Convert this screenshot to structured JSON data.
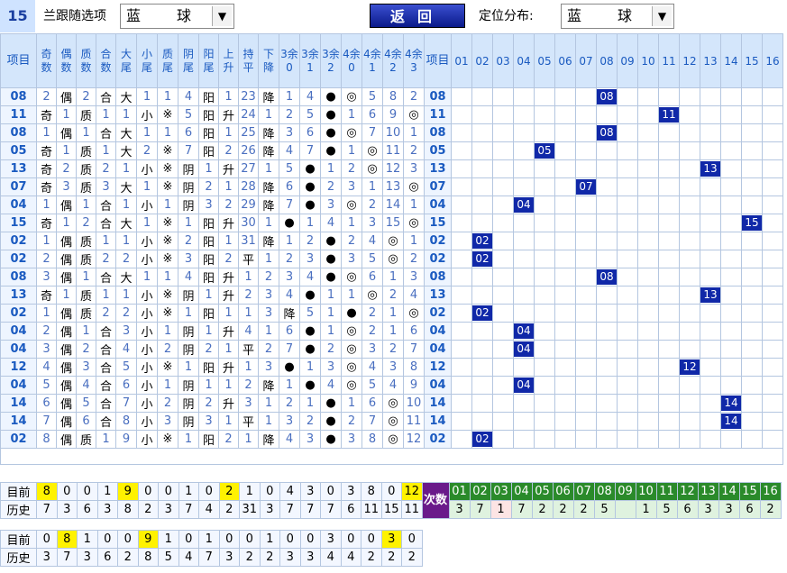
{
  "header": {
    "number": "15",
    "follow_label": "兰跟随选项",
    "follow_value": "蓝　球",
    "back_label": "返回",
    "pos_label": "定位分布:",
    "pos_value": "蓝　球"
  },
  "columns": [
    "奇数",
    "偶数",
    "质数",
    "合数",
    "大尾",
    "小尾",
    "质尾",
    "阴尾",
    "阳尾",
    "上升",
    "持平",
    "下降",
    "3余0",
    "3余1",
    "3余2",
    "4余0",
    "4余1",
    "4余2",
    "4余3"
  ],
  "item_label": "项目",
  "pos_numbers": [
    "01",
    "02",
    "03",
    "04",
    "05",
    "06",
    "07",
    "08",
    "09",
    "10",
    "11",
    "12",
    "13",
    "14",
    "15",
    "16"
  ],
  "rows": [
    {
      "item": "08",
      "cells": [
        "2",
        "偶",
        "2",
        "合",
        "大",
        "1",
        "1",
        "4",
        "阳",
        "1",
        "23",
        "降",
        "1",
        "4",
        "●",
        "◎",
        "5",
        "8",
        "2"
      ]
    },
    {
      "item": "11",
      "cells": [
        "奇",
        "1",
        "质",
        "1",
        "1",
        "小",
        "※",
        "5",
        "阳",
        "升",
        "24",
        "1",
        "2",
        "5",
        "●",
        "1",
        "6",
        "9",
        "◎"
      ]
    },
    {
      "item": "08",
      "cells": [
        "1",
        "偶",
        "1",
        "合",
        "大",
        "1",
        "1",
        "6",
        "阳",
        "1",
        "25",
        "降",
        "3",
        "6",
        "●",
        "◎",
        "7",
        "10",
        "1"
      ]
    },
    {
      "item": "05",
      "cells": [
        "奇",
        "1",
        "质",
        "1",
        "大",
        "2",
        "※",
        "7",
        "阳",
        "2",
        "26",
        "降",
        "4",
        "7",
        "●",
        "1",
        "◎",
        "11",
        "2"
      ]
    },
    {
      "item": "13",
      "cells": [
        "奇",
        "2",
        "质",
        "2",
        "1",
        "小",
        "※",
        "阴",
        "1",
        "升",
        "27",
        "1",
        "5",
        "●",
        "1",
        "2",
        "◎",
        "12",
        "3"
      ]
    },
    {
      "item": "07",
      "cells": [
        "奇",
        "3",
        "质",
        "3",
        "大",
        "1",
        "※",
        "阴",
        "2",
        "1",
        "28",
        "降",
        "6",
        "●",
        "2",
        "3",
        "1",
        "13",
        "◎"
      ]
    },
    {
      "item": "04",
      "cells": [
        "1",
        "偶",
        "1",
        "合",
        "1",
        "小",
        "1",
        "阴",
        "3",
        "2",
        "29",
        "降",
        "7",
        "●",
        "3",
        "◎",
        "2",
        "14",
        "1"
      ]
    },
    {
      "item": "15",
      "cells": [
        "奇",
        "1",
        "2",
        "合",
        "大",
        "1",
        "※",
        "1",
        "阳",
        "升",
        "30",
        "1",
        "●",
        "1",
        "4",
        "1",
        "3",
        "15",
        "◎"
      ]
    },
    {
      "item": "02",
      "cells": [
        "1",
        "偶",
        "质",
        "1",
        "1",
        "小",
        "※",
        "2",
        "阳",
        "1",
        "31",
        "降",
        "1",
        "2",
        "●",
        "2",
        "4",
        "◎",
        "1"
      ]
    },
    {
      "item": "02",
      "cells": [
        "2",
        "偶",
        "质",
        "2",
        "2",
        "小",
        "※",
        "3",
        "阳",
        "2",
        "平",
        "1",
        "2",
        "3",
        "●",
        "3",
        "5",
        "◎",
        "2"
      ]
    },
    {
      "item": "08",
      "cells": [
        "3",
        "偶",
        "1",
        "合",
        "大",
        "1",
        "1",
        "4",
        "阳",
        "升",
        "1",
        "2",
        "3",
        "4",
        "●",
        "◎",
        "6",
        "1",
        "3"
      ]
    },
    {
      "item": "13",
      "cells": [
        "奇",
        "1",
        "质",
        "1",
        "1",
        "小",
        "※",
        "阴",
        "1",
        "升",
        "2",
        "3",
        "4",
        "●",
        "1",
        "1",
        "◎",
        "2",
        "4"
      ]
    },
    {
      "item": "02",
      "cells": [
        "1",
        "偶",
        "质",
        "2",
        "2",
        "小",
        "※",
        "1",
        "阳",
        "1",
        "1",
        "3",
        "降",
        "5",
        "1",
        "●",
        "2",
        "1",
        "◎",
        "5"
      ]
    },
    {
      "item": "04",
      "cells": [
        "2",
        "偶",
        "1",
        "合",
        "3",
        "小",
        "1",
        "阴",
        "1",
        "升",
        "4",
        "1",
        "6",
        "●",
        "1",
        "◎",
        "2",
        "1",
        "6"
      ]
    },
    {
      "item": "04",
      "cells": [
        "3",
        "偶",
        "2",
        "合",
        "4",
        "小",
        "2",
        "阴",
        "2",
        "1",
        "平",
        "2",
        "7",
        "●",
        "2",
        "◎",
        "3",
        "2",
        "7"
      ]
    },
    {
      "item": "12",
      "cells": [
        "4",
        "偶",
        "3",
        "合",
        "5",
        "小",
        "※",
        "1",
        "阳",
        "升",
        "1",
        "3",
        "●",
        "1",
        "3",
        "◎",
        "4",
        "3",
        "8"
      ]
    },
    {
      "item": "04",
      "cells": [
        "5",
        "偶",
        "4",
        "合",
        "6",
        "小",
        "1",
        "阴",
        "1",
        "1",
        "2",
        "降",
        "1",
        "●",
        "4",
        "◎",
        "5",
        "4",
        "9"
      ]
    },
    {
      "item": "14",
      "cells": [
        "6",
        "偶",
        "5",
        "合",
        "7",
        "小",
        "2",
        "阴",
        "2",
        "升",
        "3",
        "1",
        "2",
        "1",
        "●",
        "1",
        "6",
        "◎",
        "10"
      ]
    },
    {
      "item": "14",
      "cells": [
        "7",
        "偶",
        "6",
        "合",
        "8",
        "小",
        "3",
        "阴",
        "3",
        "1",
        "平",
        "1",
        "3",
        "2",
        "●",
        "2",
        "7",
        "◎",
        "11"
      ]
    },
    {
      "item": "02",
      "cells": [
        "8",
        "偶",
        "质",
        "1",
        "9",
        "小",
        "※",
        "1",
        "阳",
        "2",
        "1",
        "降",
        "4",
        "3",
        "●",
        "3",
        "8",
        "◎",
        "12"
      ]
    }
  ],
  "bottom": {
    "current_label": "目前",
    "history_label": "历史",
    "cishu_label": "次数",
    "current": [
      "8",
      "0",
      "0",
      "1",
      "9",
      "0",
      "0",
      "1",
      "0",
      "2",
      "1",
      "0",
      "4",
      "3",
      "0",
      "3",
      "8",
      "0",
      "12"
    ],
    "history": [
      "7",
      "3",
      "6",
      "3",
      "8",
      "2",
      "3",
      "7",
      "4",
      "2",
      "31",
      "3",
      "7",
      "7",
      "7",
      "6",
      "11",
      "15",
      "11"
    ],
    "pos_history": [
      "3",
      "7",
      "1",
      "7",
      "2",
      "2",
      "2",
      "5",
      "",
      "1",
      "5",
      "6",
      "3",
      "3",
      "6",
      "2"
    ],
    "current2": [
      "0",
      "8",
      "1",
      "0",
      "0",
      "9",
      "1",
      "0",
      "1",
      "0",
      "0",
      "1",
      "0",
      "0",
      "3",
      "0",
      "0",
      "3",
      "0"
    ],
    "history2": [
      "3",
      "7",
      "3",
      "6",
      "2",
      "8",
      "5",
      "4",
      "7",
      "3",
      "2",
      "2",
      "3",
      "3",
      "4",
      "4",
      "2",
      "2",
      "2"
    ]
  }
}
